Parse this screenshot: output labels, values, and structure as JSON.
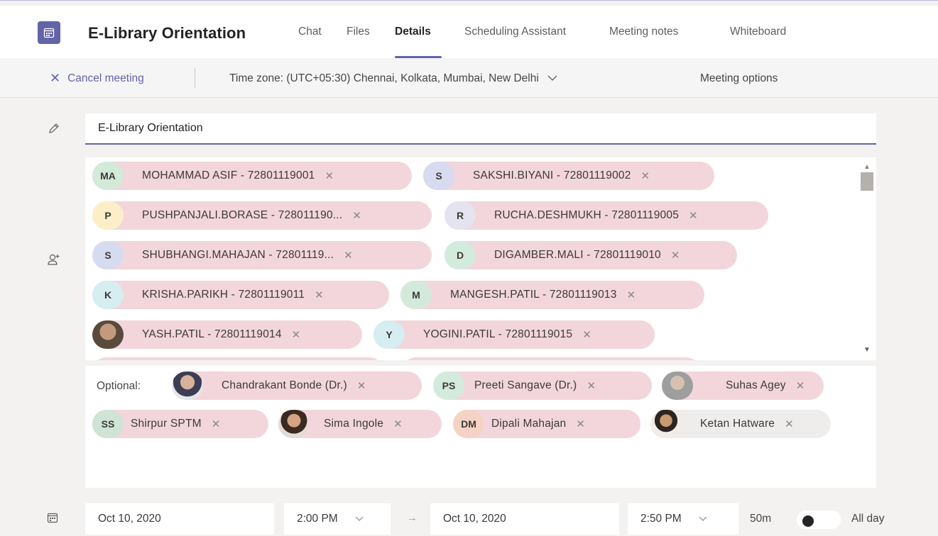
{
  "header": {
    "title": "E-Library Orientation",
    "tabs": [
      {
        "label": "Chat",
        "active": false
      },
      {
        "label": "Files",
        "active": false
      },
      {
        "label": "Details",
        "active": true
      },
      {
        "label": "Scheduling Assistant",
        "active": false
      },
      {
        "label": "Meeting notes",
        "active": false
      },
      {
        "label": "Whiteboard",
        "active": false
      }
    ]
  },
  "toolbar": {
    "cancel_label": "Cancel meeting",
    "timezone": "Time zone: (UTC+05:30) Chennai, Kolkata, Mumbai, New Delhi",
    "meeting_options": "Meeting options"
  },
  "form": {
    "title_value": "E-Library Orientation",
    "optional_label": "Optional:"
  },
  "attendees": [
    {
      "initials": "MA",
      "name": "MOHAMMAD ASIF - 72801119001",
      "color": "#d3ead8"
    },
    {
      "initials": "S",
      "name": "SAKSHI.BIYANI - 72801119002",
      "color": "#d8daf0"
    },
    {
      "initials": "P",
      "name": "PUSHPANJALI.BORASE - 728011190...",
      "color": "#fcefc8"
    },
    {
      "initials": "R",
      "name": "RUCHA.DESHMUKH - 72801119005",
      "color": "#e3e4f0"
    },
    {
      "initials": "S",
      "name": "SHUBHANGI.MAHAJAN - 72801119...",
      "color": "#d6dcf0"
    },
    {
      "initials": "D",
      "name": "DIGAMBER.MALI - 72801119010",
      "color": "#d3ebdc"
    },
    {
      "initials": "K",
      "name": "KRISHA.PARIKH - 72801119011",
      "color": "#d6edf2"
    },
    {
      "initials": "M",
      "name": "MANGESH.PATIL - 72801119013",
      "color": "#d3eadb"
    },
    {
      "initials": "",
      "name": "YASH.PATIL - 72801119014",
      "color": "photo"
    },
    {
      "initials": "Y",
      "name": "YOGINI.PATIL - 72801119015",
      "color": "#d6edf2"
    }
  ],
  "optional_attendees": [
    {
      "initials": "",
      "name": "Chandrakant Bonde (Dr.)",
      "color": "photo"
    },
    {
      "initials": "PS",
      "name": "Preeti Sangave (Dr.)",
      "color": "#d3ebdc"
    },
    {
      "initials": "",
      "name": "Suhas Agey",
      "color": "photo"
    },
    {
      "initials": "SS",
      "name": "Shirpur SPTM",
      "color": "#cfe4d4"
    },
    {
      "initials": "",
      "name": "Sima Ingole",
      "color": "photo"
    },
    {
      "initials": "DM",
      "name": "Dipali Mahajan",
      "color": "#f5d3c4"
    },
    {
      "initials": "",
      "name": "Ketan Hatware",
      "color": "photo"
    }
  ],
  "schedule": {
    "start_date": "Oct 10, 2020",
    "start_time": "2:00 PM",
    "end_date": "Oct 10, 2020",
    "end_time": "2:50 PM",
    "duration": "50m",
    "all_day_label": "All day",
    "all_day_on": false
  },
  "colors": {
    "accent": "#6264a7",
    "chip_background": "#f2d6dc"
  }
}
